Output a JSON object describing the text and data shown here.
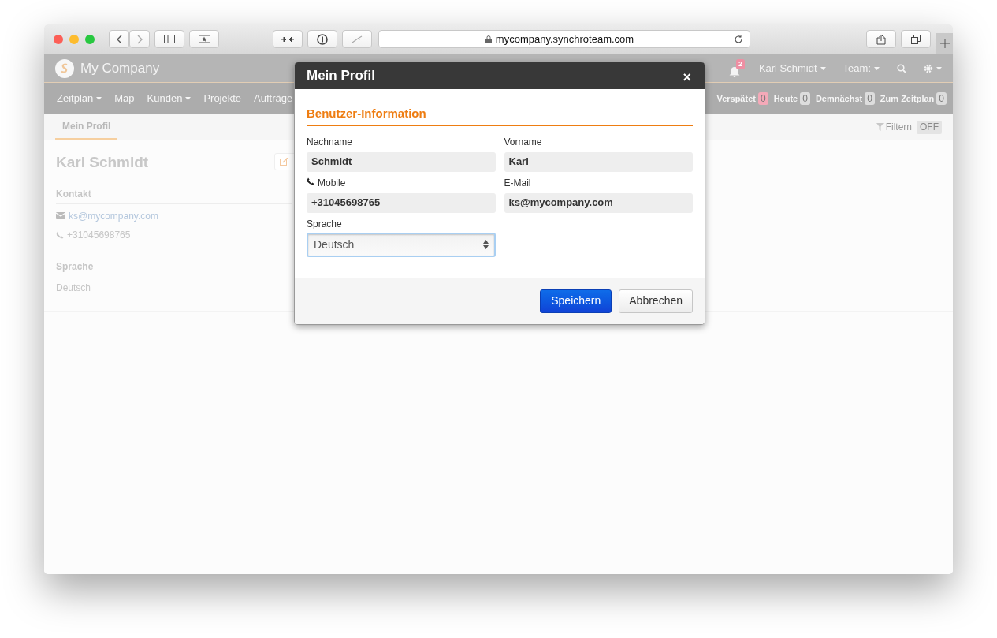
{
  "browser": {
    "url": "mycompany.synchroteam.com"
  },
  "header": {
    "brand": "My Company",
    "notification_count": "2",
    "user": "Karl Schmidt",
    "team": "Team:"
  },
  "nav": {
    "items": [
      {
        "label": "Zeitplan",
        "dropdown": true
      },
      {
        "label": "Map",
        "dropdown": false
      },
      {
        "label": "Kunden",
        "dropdown": true
      },
      {
        "label": "Projekte",
        "dropdown": false
      },
      {
        "label": "Aufträge",
        "dropdown": false
      }
    ],
    "counters": [
      {
        "label": "Verspätet",
        "count": "0",
        "color": "#f4a9b8"
      },
      {
        "label": "Heute",
        "count": "0",
        "color": "#dddddd"
      },
      {
        "label": "Demnächst",
        "count": "0",
        "color": "#dddddd"
      },
      {
        "label": "Zum Zeitplan",
        "count": "0",
        "color": "#dddddd"
      }
    ]
  },
  "tabs": [
    {
      "label": "Mein Profil",
      "selected": true
    }
  ],
  "filter": {
    "label": "Filtern",
    "toggle": "OFF"
  },
  "profile": {
    "name": "Karl Schmidt",
    "sections": [
      {
        "title": "Kontakt",
        "lines": [
          {
            "kind": "email",
            "text": "ks@mycompany.com"
          },
          {
            "kind": "phone",
            "text": "+31045698765"
          }
        ]
      },
      {
        "title": "Sprache",
        "lines": [
          {
            "kind": "text",
            "text": "Deutsch"
          }
        ]
      }
    ]
  },
  "modal": {
    "title": "Mein Profil",
    "close": "×",
    "section_title": "Benutzer-Information",
    "fields": [
      {
        "label": "Nachname",
        "value": "Schmidt",
        "kind": "text"
      },
      {
        "label": "Vorname",
        "value": "Karl",
        "kind": "text"
      },
      {
        "label": "Mobile",
        "value": "+31045698765",
        "kind": "phone"
      },
      {
        "label": "E-Mail",
        "value": "ks@mycompany.com",
        "kind": "text"
      },
      {
        "label": "Sprache",
        "value": "Deutsch",
        "kind": "select"
      }
    ],
    "buttons": [
      {
        "label": "Speichern",
        "kind": "primary"
      },
      {
        "label": "Abbrechen",
        "kind": "default"
      }
    ]
  }
}
